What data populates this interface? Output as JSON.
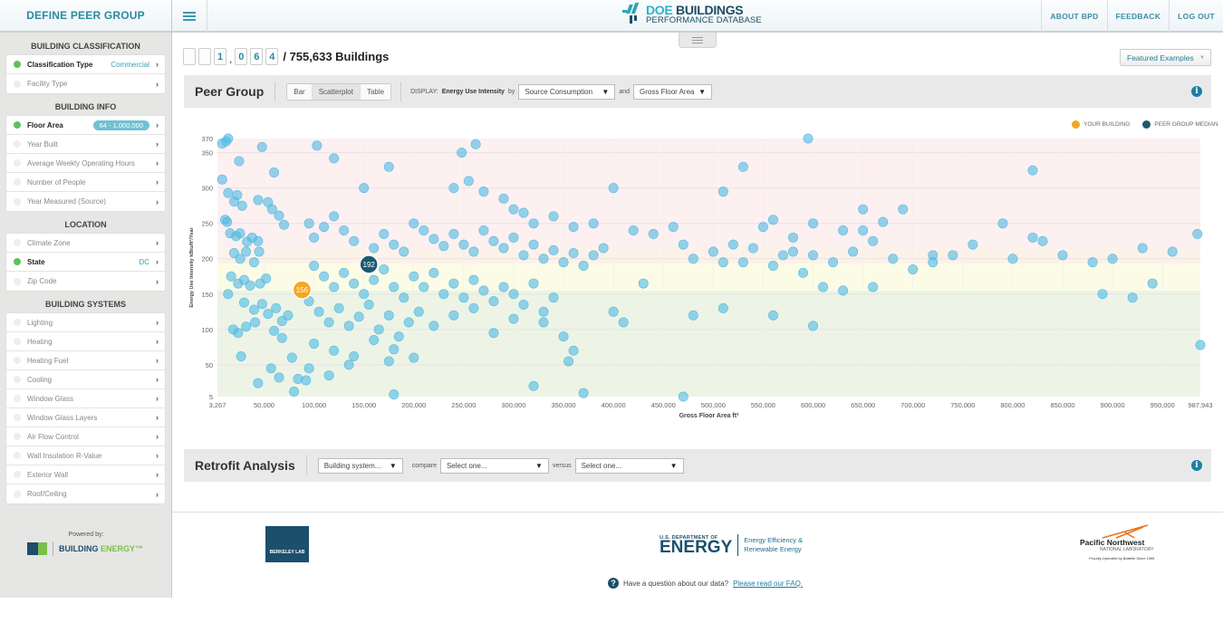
{
  "sidebar": {
    "title": "DEFINE PEER GROUP",
    "sections": [
      {
        "title": "BUILDING CLASSIFICATION",
        "items": [
          {
            "label": "Classification Type",
            "active": true,
            "value": "Commercial"
          },
          {
            "label": "Facility Type",
            "active": false
          }
        ]
      },
      {
        "title": "BUILDING INFO",
        "items": [
          {
            "label": "Floor Area",
            "active": true,
            "pill": "64 - 1,000,000"
          },
          {
            "label": "Year Built",
            "active": false
          },
          {
            "label": "Average Weekly Operating Hours",
            "active": false
          },
          {
            "label": "Number of People",
            "active": false
          },
          {
            "label": "Year Measured (Source)",
            "active": false
          }
        ]
      },
      {
        "title": "LOCATION",
        "items": [
          {
            "label": "Climate Zone",
            "active": false
          },
          {
            "label": "State",
            "active": true,
            "value": "DC"
          },
          {
            "label": "Zip Code",
            "active": false
          }
        ]
      },
      {
        "title": "BUILDING SYSTEMS",
        "items": [
          {
            "label": "Lighting",
            "active": false
          },
          {
            "label": "Heating",
            "active": false
          },
          {
            "label": "Heating Fuel",
            "active": false
          },
          {
            "label": "Cooling",
            "active": false
          },
          {
            "label": "Window Glass",
            "active": false
          },
          {
            "label": "Window Glass Layers",
            "active": false
          },
          {
            "label": "Air Flow Control",
            "active": false
          },
          {
            "label": "Wall Insulation R-Value",
            "active": false
          },
          {
            "label": "Exterior Wall",
            "active": false
          },
          {
            "label": "Roof/Ceiling",
            "active": false
          }
        ]
      }
    ],
    "powered_by": "Powered by:",
    "brand_a": "BUILDING ",
    "brand_b": "ENERGY™"
  },
  "header": {
    "logo_line1a": "DOE",
    "logo_line1b": "BUILDINGS",
    "logo_line2": "PERFORMANCE DATABASE",
    "nav": [
      "ABOUT BPD",
      "FEEDBACK",
      "LOG OUT"
    ]
  },
  "counter": {
    "digits": [
      "",
      "",
      "1",
      "0",
      "6",
      "4"
    ],
    "total": "/ 755,633 Buildings"
  },
  "featured_label": "Featured Examples",
  "peer_group": {
    "title": "Peer Group",
    "views": [
      "Bar",
      "Scatterplot",
      "Table"
    ],
    "active_view": "Scatterplot",
    "display_label": "DISPLAY:",
    "metric": "Energy Use Intensity",
    "by": "by",
    "select1": "Source Consumption",
    "and": "and",
    "select2": "Gross Floor Area"
  },
  "retrofit": {
    "title": "Retrofit Analysis",
    "select1": "Building system...",
    "compare": "compare",
    "select2": "Select one...",
    "versus": "versus",
    "select3": "Select one..."
  },
  "chart_data": {
    "type": "scatter",
    "xlabel": "Gross Floor Area ft²",
    "ylabel": "Energy Use Intensity kBtu/ft²/Year",
    "xlim": [
      3267,
      987943
    ],
    "ylim": [
      5,
      370
    ],
    "x_ticks": [
      "3,267",
      "50,000",
      "100,000",
      "150,000",
      "200,000",
      "250,000",
      "300,000",
      "350,000",
      "400,000",
      "450,000",
      "500,000",
      "550,000",
      "600,000",
      "650,000",
      "700,000",
      "750,000",
      "800,000",
      "850,000",
      "900,000",
      "950,000",
      "987,943"
    ],
    "x_tick_values": [
      3267,
      50000,
      100000,
      150000,
      200000,
      250000,
      300000,
      350000,
      400000,
      450000,
      500000,
      550000,
      600000,
      650000,
      700000,
      750000,
      800000,
      850000,
      900000,
      950000,
      987943
    ],
    "y_ticks": [
      "5",
      "50",
      "100",
      "150",
      "200",
      "250",
      "300",
      "350",
      "370"
    ],
    "y_tick_values": [
      5,
      50,
      100,
      150,
      200,
      250,
      300,
      350,
      370
    ],
    "bands": [
      {
        "from": 217,
        "to": 370,
        "color": "#fdf0f1"
      },
      {
        "from": 193,
        "to": 217,
        "color": "#fdf2ea"
      },
      {
        "from": 155,
        "to": 193,
        "color": "#fcfbe6"
      },
      {
        "from": 5,
        "to": 155,
        "color": "#edf4e6"
      }
    ],
    "legend": [
      {
        "label": "YOUR BUILDING",
        "color": "#f5a623"
      },
      {
        "label": "PEER GROUP MEDIAN",
        "color": "#1c5a70"
      }
    ],
    "your_building": {
      "x": 88000,
      "y": 156,
      "label": "156"
    },
    "median": {
      "x": 155000,
      "y": 192,
      "label": "192"
    },
    "point_color": "#4fb9e3",
    "points": [
      [
        8000,
        363
      ],
      [
        12000,
        366
      ],
      [
        14000,
        370
      ],
      [
        25000,
        338
      ],
      [
        48000,
        358
      ],
      [
        60000,
        322
      ],
      [
        103000,
        360
      ],
      [
        120000,
        342
      ],
      [
        150000,
        300
      ],
      [
        175000,
        330
      ],
      [
        248000,
        350
      ],
      [
        262000,
        362
      ],
      [
        8000,
        312
      ],
      [
        14000,
        293
      ],
      [
        23000,
        290
      ],
      [
        20000,
        281
      ],
      [
        28000,
        275
      ],
      [
        44000,
        283
      ],
      [
        54000,
        280
      ],
      [
        58000,
        270
      ],
      [
        65000,
        261
      ],
      [
        70000,
        248
      ],
      [
        11000,
        255
      ],
      [
        13000,
        252
      ],
      [
        16000,
        236
      ],
      [
        22000,
        232
      ],
      [
        26000,
        236
      ],
      [
        33000,
        224
      ],
      [
        38000,
        230
      ],
      [
        44000,
        225
      ],
      [
        45000,
        210
      ],
      [
        20000,
        208
      ],
      [
        26000,
        200
      ],
      [
        32000,
        210
      ],
      [
        40000,
        195
      ],
      [
        17000,
        175
      ],
      [
        24000,
        165
      ],
      [
        30000,
        170
      ],
      [
        36000,
        162
      ],
      [
        46000,
        165
      ],
      [
        52000,
        172
      ],
      [
        14000,
        150
      ],
      [
        30000,
        138
      ],
      [
        40000,
        128
      ],
      [
        48000,
        136
      ],
      [
        54000,
        122
      ],
      [
        62000,
        130
      ],
      [
        68000,
        112
      ],
      [
        74000,
        120
      ],
      [
        19000,
        100
      ],
      [
        24000,
        95
      ],
      [
        32000,
        104
      ],
      [
        41000,
        110
      ],
      [
        60000,
        98
      ],
      [
        68000,
        88
      ],
      [
        27000,
        62
      ],
      [
        57000,
        45
      ],
      [
        78000,
        60
      ],
      [
        44000,
        24
      ],
      [
        65000,
        32
      ],
      [
        84000,
        30
      ],
      [
        92000,
        28
      ],
      [
        80000,
        12
      ],
      [
        95000,
        250
      ],
      [
        100000,
        230
      ],
      [
        110000,
        245
      ],
      [
        120000,
        260
      ],
      [
        130000,
        240
      ],
      [
        140000,
        225
      ],
      [
        160000,
        215
      ],
      [
        170000,
        235
      ],
      [
        180000,
        220
      ],
      [
        190000,
        210
      ],
      [
        200000,
        250
      ],
      [
        210000,
        240
      ],
      [
        220000,
        228
      ],
      [
        230000,
        218
      ],
      [
        240000,
        235
      ],
      [
        250000,
        220
      ],
      [
        260000,
        210
      ],
      [
        270000,
        240
      ],
      [
        280000,
        225
      ],
      [
        290000,
        215
      ],
      [
        300000,
        230
      ],
      [
        310000,
        205
      ],
      [
        320000,
        220
      ],
      [
        330000,
        200
      ],
      [
        340000,
        212
      ],
      [
        350000,
        195
      ],
      [
        360000,
        208
      ],
      [
        370000,
        190
      ],
      [
        380000,
        205
      ],
      [
        390000,
        215
      ],
      [
        100000,
        190
      ],
      [
        110000,
        175
      ],
      [
        120000,
        160
      ],
      [
        130000,
        180
      ],
      [
        140000,
        165
      ],
      [
        150000,
        150
      ],
      [
        160000,
        170
      ],
      [
        170000,
        185
      ],
      [
        180000,
        160
      ],
      [
        190000,
        145
      ],
      [
        200000,
        175
      ],
      [
        210000,
        160
      ],
      [
        220000,
        180
      ],
      [
        230000,
        150
      ],
      [
        240000,
        165
      ],
      [
        250000,
        145
      ],
      [
        260000,
        170
      ],
      [
        270000,
        155
      ],
      [
        280000,
        140
      ],
      [
        290000,
        160
      ],
      [
        300000,
        150
      ],
      [
        310000,
        135
      ],
      [
        320000,
        165
      ],
      [
        330000,
        125
      ],
      [
        340000,
        145
      ],
      [
        95000,
        140
      ],
      [
        105000,
        125
      ],
      [
        115000,
        110
      ],
      [
        125000,
        130
      ],
      [
        135000,
        105
      ],
      [
        145000,
        118
      ],
      [
        155000,
        135
      ],
      [
        165000,
        100
      ],
      [
        175000,
        120
      ],
      [
        185000,
        90
      ],
      [
        195000,
        110
      ],
      [
        205000,
        125
      ],
      [
        220000,
        105
      ],
      [
        240000,
        120
      ],
      [
        260000,
        130
      ],
      [
        280000,
        95
      ],
      [
        300000,
        115
      ],
      [
        330000,
        110
      ],
      [
        350000,
        90
      ],
      [
        100000,
        80
      ],
      [
        120000,
        70
      ],
      [
        140000,
        62
      ],
      [
        160000,
        85
      ],
      [
        180000,
        72
      ],
      [
        200000,
        60
      ],
      [
        95000,
        45
      ],
      [
        115000,
        35
      ],
      [
        135000,
        50
      ],
      [
        175000,
        55
      ],
      [
        360000,
        70
      ],
      [
        355000,
        55
      ],
      [
        320000,
        20
      ],
      [
        370000,
        10
      ],
      [
        180000,
        8
      ],
      [
        470000,
        5
      ],
      [
        240000,
        300
      ],
      [
        255000,
        310
      ],
      [
        270000,
        295
      ],
      [
        290000,
        285
      ],
      [
        300000,
        270
      ],
      [
        310000,
        265
      ],
      [
        320000,
        250
      ],
      [
        340000,
        260
      ],
      [
        360000,
        245
      ],
      [
        380000,
        250
      ],
      [
        400000,
        300
      ],
      [
        420000,
        240
      ],
      [
        440000,
        235
      ],
      [
        460000,
        245
      ],
      [
        470000,
        220
      ],
      [
        480000,
        200
      ],
      [
        500000,
        210
      ],
      [
        510000,
        195
      ],
      [
        520000,
        220
      ],
      [
        530000,
        195
      ],
      [
        540000,
        215
      ],
      [
        550000,
        245
      ],
      [
        560000,
        190
      ],
      [
        570000,
        205
      ],
      [
        580000,
        210
      ],
      [
        590000,
        180
      ],
      [
        600000,
        205
      ],
      [
        620000,
        195
      ],
      [
        640000,
        210
      ],
      [
        650000,
        240
      ],
      [
        660000,
        225
      ],
      [
        680000,
        200
      ],
      [
        700000,
        185
      ],
      [
        720000,
        195
      ],
      [
        740000,
        205
      ],
      [
        760000,
        220
      ],
      [
        790000,
        250
      ],
      [
        800000,
        200
      ],
      [
        820000,
        230
      ],
      [
        830000,
        225
      ],
      [
        850000,
        205
      ],
      [
        880000,
        195
      ],
      [
        900000,
        200
      ],
      [
        930000,
        215
      ],
      [
        960000,
        210
      ],
      [
        985000,
        235
      ],
      [
        510000,
        295
      ],
      [
        530000,
        330
      ],
      [
        595000,
        370
      ],
      [
        400000,
        125
      ],
      [
        410000,
        110
      ],
      [
        430000,
        165
      ],
      [
        480000,
        120
      ],
      [
        510000,
        130
      ],
      [
        560000,
        120
      ],
      [
        600000,
        105
      ],
      [
        610000,
        160
      ],
      [
        630000,
        155
      ],
      [
        660000,
        160
      ],
      [
        890000,
        150
      ],
      [
        920000,
        145
      ],
      [
        940000,
        165
      ],
      [
        987943,
        78
      ],
      [
        820000,
        325
      ],
      [
        580000,
        230
      ],
      [
        560000,
        255
      ],
      [
        600000,
        250
      ],
      [
        630000,
        240
      ],
      [
        650000,
        270
      ],
      [
        670000,
        252
      ],
      [
        690000,
        270
      ],
      [
        720000,
        205
      ]
    ]
  },
  "footer": {
    "berkeley": "BERKELEY LAB",
    "doe_small": "U.S. DEPARTMENT OF",
    "doe_big": "ENERGY",
    "doe_right1": "Energy Efficiency &",
    "doe_right2": "Renewable Energy",
    "pnnl_name": "Pacific Northwest",
    "pnnl_sub": "NATIONAL LABORATORY",
    "pnnl_op": "Proudly Operated by Battelle Since 1965",
    "faq_text": "Have a question about our data?",
    "faq_link": "Please read our FAQ."
  },
  "colors": {
    "accent": "#2a8aa0",
    "active_dot": "#5cc35c",
    "info": "#1b7fa5"
  }
}
